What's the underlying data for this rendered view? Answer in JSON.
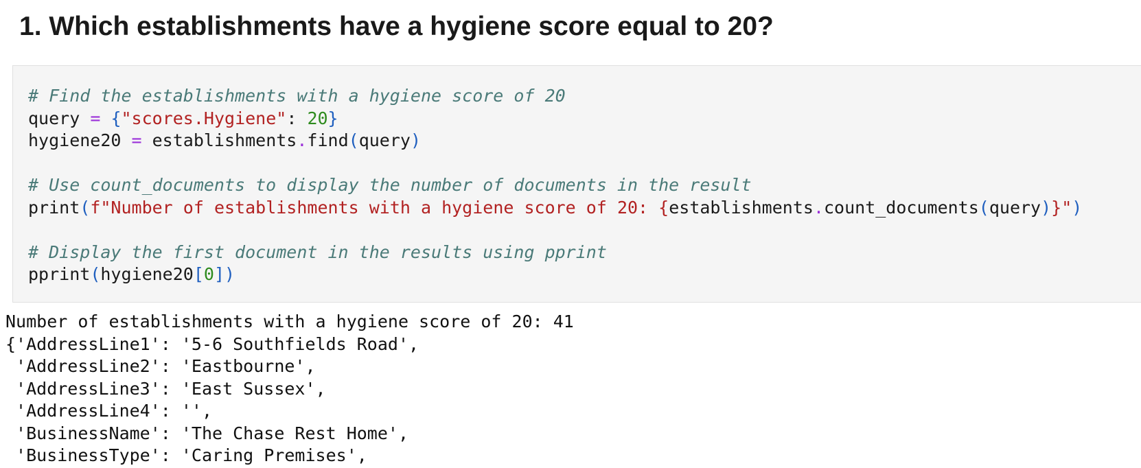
{
  "heading": "1. Which establishments have a hygiene score equal to 20?",
  "code_lines": [
    [
      {
        "t": "# Find the establishments with a hygiene score of 20",
        "k": "c"
      }
    ],
    [
      {
        "t": "query ",
        "k": "t"
      },
      {
        "t": "=",
        "k": "o"
      },
      {
        "t": " ",
        "k": "t"
      },
      {
        "t": "{",
        "k": "p"
      },
      {
        "t": "\"scores.Hygiene\"",
        "k": "s"
      },
      {
        "t": ": ",
        "k": "t"
      },
      {
        "t": "20",
        "k": "n"
      },
      {
        "t": "}",
        "k": "p"
      }
    ],
    [
      {
        "t": "hygiene20 ",
        "k": "t"
      },
      {
        "t": "=",
        "k": "o"
      },
      {
        "t": " establishments",
        "k": "t"
      },
      {
        "t": ".",
        "k": "o"
      },
      {
        "t": "find",
        "k": "t"
      },
      {
        "t": "(",
        "k": "p"
      },
      {
        "t": "query",
        "k": "t"
      },
      {
        "t": ")",
        "k": "p"
      }
    ],
    [],
    [
      {
        "t": "# Use count_documents to display the number of documents in the result",
        "k": "c"
      }
    ],
    [
      {
        "t": "print",
        "k": "t"
      },
      {
        "t": "(",
        "k": "p"
      },
      {
        "t": "f\"Number of establishments with a hygiene score of 20: ",
        "k": "s"
      },
      {
        "t": "{",
        "k": "s"
      },
      {
        "t": "establishments",
        "k": "t"
      },
      {
        "t": ".",
        "k": "o"
      },
      {
        "t": "count_documents",
        "k": "t"
      },
      {
        "t": "(",
        "k": "p"
      },
      {
        "t": "query",
        "k": "t"
      },
      {
        "t": ")",
        "k": "p"
      },
      {
        "t": "}\"",
        "k": "s"
      },
      {
        "t": ")",
        "k": "p"
      }
    ],
    [],
    [
      {
        "t": "# Display the first document in the results using pprint",
        "k": "c"
      }
    ],
    [
      {
        "t": "pprint",
        "k": "t"
      },
      {
        "t": "(",
        "k": "p"
      },
      {
        "t": "hygiene20",
        "k": "t"
      },
      {
        "t": "[",
        "k": "p"
      },
      {
        "t": "0",
        "k": "n"
      },
      {
        "t": "]",
        "k": "p"
      },
      {
        "t": ")",
        "k": "p"
      }
    ]
  ],
  "output_lines": [
    "Number of establishments with a hygiene score of 20: 41",
    "{'AddressLine1': '5-6 Southfields Road',",
    " 'AddressLine2': 'Eastbourne',",
    " 'AddressLine3': 'East Sussex',",
    " 'AddressLine4': '',",
    " 'BusinessName': 'The Chase Rest Home',",
    " 'BusinessType': 'Caring Premises',"
  ]
}
